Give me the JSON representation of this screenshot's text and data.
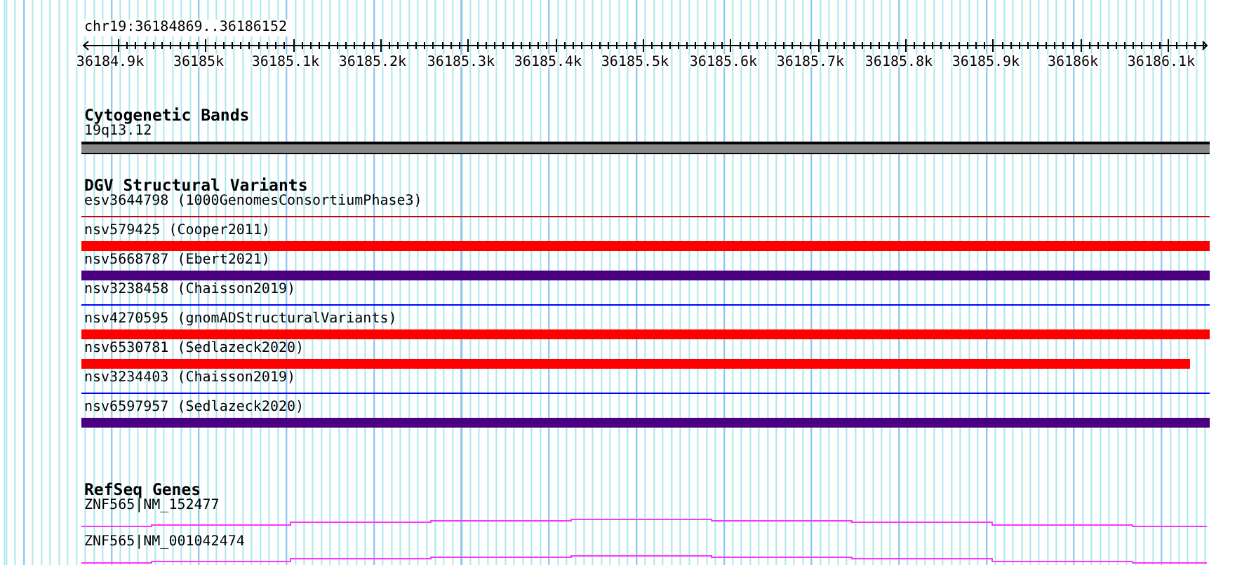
{
  "ruler": {
    "location": "chr19:36184869..36186152",
    "ticks": [
      "36184.9k",
      "36185k",
      "36185.1k",
      "36185.2k",
      "36185.3k",
      "36185.4k",
      "36185.5k",
      "36185.6k",
      "36185.7k",
      "36185.8k",
      "36185.9k",
      "36186k",
      "36186.1k"
    ]
  },
  "tracks": [
    {
      "kind": "bands",
      "title": "Cytogenetic Bands",
      "features": [
        {
          "label": "19q13.12",
          "kind": "band",
          "color": "#888888",
          "continues_right": true
        }
      ]
    },
    {
      "kind": "variants",
      "title": "DGV Structural Variants",
      "features": [
        {
          "label": "esv3644798 (1000GenomesConsortiumPhase3)",
          "kind": "thin",
          "color": "#cc0000",
          "continues_right": true
        },
        {
          "label": "nsv579425 (Cooper2011)",
          "kind": "thick",
          "color": "#ff0000",
          "continues_right": true
        },
        {
          "label": "nsv5668787 (Ebert2021)",
          "kind": "thick",
          "color": "#4b0082",
          "continues_right": true
        },
        {
          "label": "nsv3238458 (Chaisson2019)",
          "kind": "thin",
          "color": "#0000ff",
          "continues_right": true
        },
        {
          "label": "nsv4270595 (gnomADStructuralVariants)",
          "kind": "thick",
          "color": "#ff0000",
          "continues_right": true
        },
        {
          "label": "nsv6530781 (Sedlazeck2020)",
          "kind": "thick",
          "color": "#ff0000",
          "continues_right": false
        },
        {
          "label": "nsv3234403 (Chaisson2019)",
          "kind": "thin",
          "color": "#0000ff",
          "continues_right": true
        },
        {
          "label": "nsv6597957 (Sedlazeck2020)",
          "kind": "thick",
          "color": "#4b0082",
          "continues_right": true
        }
      ]
    },
    {
      "kind": "genes",
      "title": "RefSeq Genes",
      "features": [
        {
          "label": "ZNF565|NM_152477",
          "kind": "gene",
          "color": "#ff33ff",
          "continues_right": true
        },
        {
          "label": "ZNF565|NM_001042474",
          "kind": "gene",
          "color": "#ff33ff",
          "continues_right": true
        }
      ]
    }
  ]
}
